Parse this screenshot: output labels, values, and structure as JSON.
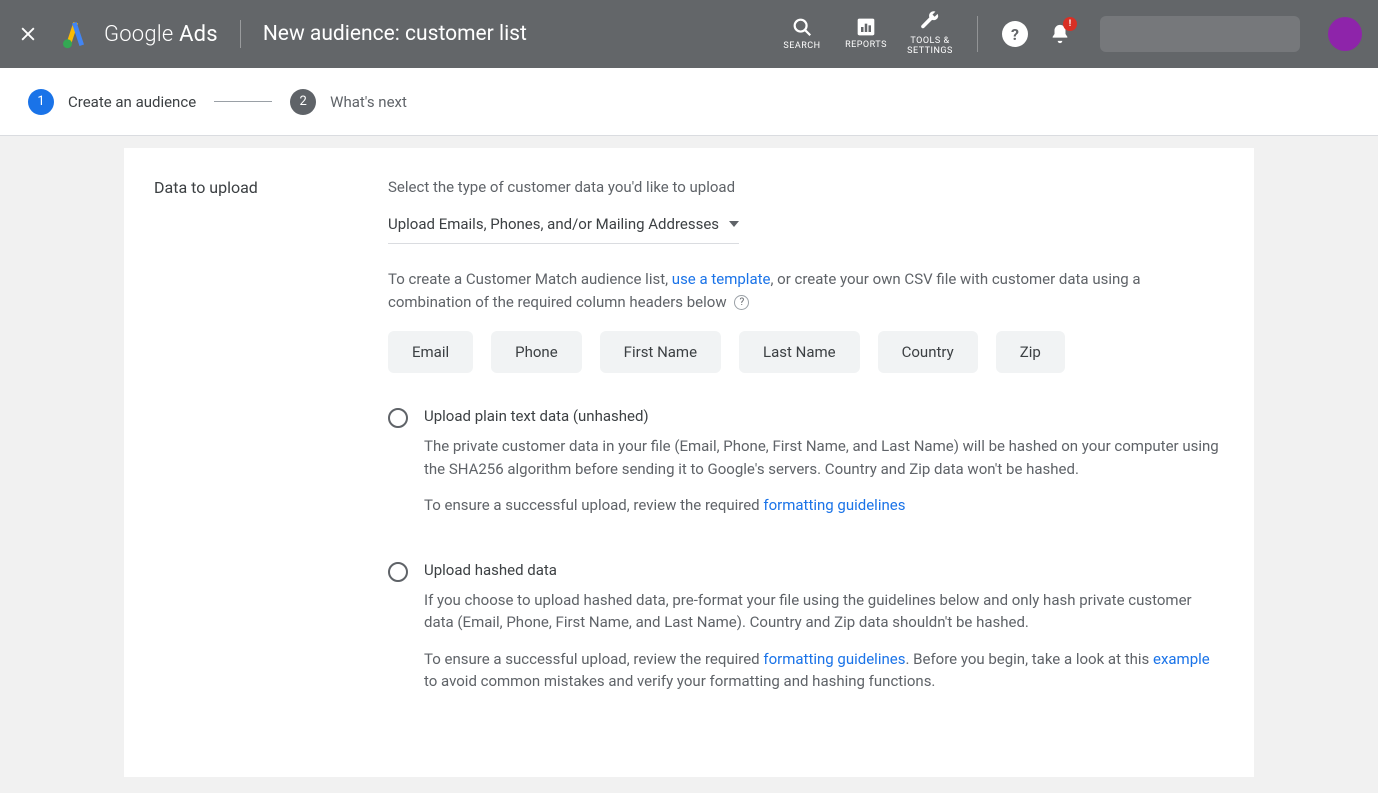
{
  "header": {
    "brand_thin": "Google",
    "brand_bold": " Ads",
    "page_title": "New audience: customer list",
    "tools": {
      "search": "SEARCH",
      "reports": "REPORTS",
      "tools_settings_1": "TOOLS &",
      "tools_settings_2": "SETTINGS"
    },
    "help_glyph": "?",
    "notif_badge": "!"
  },
  "stepper": {
    "step1_num": "1",
    "step1_label": "Create an audience",
    "step2_num": "2",
    "step2_label": "What's next"
  },
  "card": {
    "section_label": "Data to upload",
    "intro": "Select the type of customer data you'd like to upload",
    "dropdown_value": "Upload Emails, Phones, and/or Mailing Addresses",
    "desc_pre": "To create a Customer Match audience list, ",
    "desc_link": "use a template",
    "desc_post": ", or create your own CSV file with customer data using a combination of the required column headers below ",
    "help_glyph": "?",
    "chips": [
      "Email",
      "Phone",
      "First Name",
      "Last Name",
      "Country",
      "Zip"
    ],
    "radio1": {
      "title": "Upload plain text data (unhashed)",
      "desc": "The private customer data in your file (Email, Phone, First Name, and Last Name) will be hashed on your computer using the SHA256 algorithm before sending it to Google's servers. Country and Zip data won't be hashed.",
      "hint_pre": "To ensure a successful upload, review the required ",
      "hint_link": "formatting guidelines"
    },
    "radio2": {
      "title": "Upload hashed data",
      "desc": "If you choose to upload hashed data, pre-format your file using the guidelines below and only hash private customer data (Email, Phone, First Name, and Last Name). Country and Zip data shouldn't be hashed.",
      "hint_pre": "To ensure a successful upload, review the required ",
      "hint_link1": "formatting guidelines",
      "hint_mid": ". Before you begin, take a look at this ",
      "hint_link2": "example",
      "hint_post": " to avoid common mistakes and verify your formatting and hashing functions."
    }
  }
}
